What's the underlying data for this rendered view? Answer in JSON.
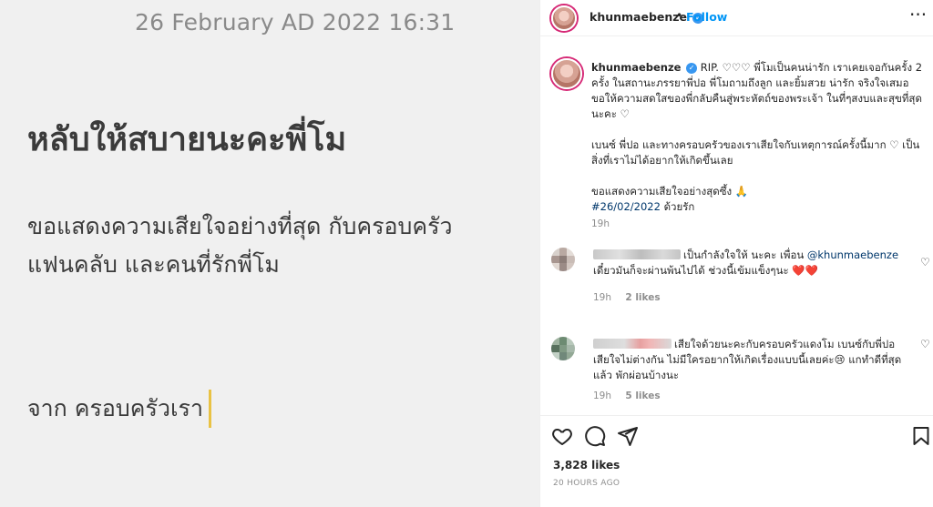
{
  "post_image": {
    "date": "26 February AD 2022 16:31",
    "headline": "หลับให้สบายนะคะพี่โม",
    "body_line1": "ขอแสดงความเสียใจอย่างที่สุด กับครอบครัว",
    "body_line2": "แฟนคลับ และคนที่รักพี่โม",
    "signature": "จาก ครอบครัวเรา"
  },
  "header": {
    "username": "khunmaebenze",
    "verified_icon": "verified-badge-icon",
    "separator": "•",
    "follow_label": "Follow",
    "more_icon": "more-options-icon",
    "more_glyph": "···"
  },
  "caption": {
    "username": "khunmaebenze",
    "para1": "RIP. ♡♡♡ พี่โมเป็นคนน่ารัก เราเคยเจอกันครั้ง 2 ครั้ง ในสถานะภรรยาพี่ปอ พี่โมถามถึงลูก และยิ้มสวย น่ารัก จริงใจเสมอ ขอให้ความสดใสของพี่กลับคืนสู่พระหัตถ์ของพระเจ้า ในที่ๆสงบและสุขที่สุดนะคะ ♡",
    "para2": "เบนซ์ พี่ปอ และทางครอบครัวของเราเสียใจกับเหตุการณ์ครั้งนี้มาก ♡ เป็นสิ่งที่เราไม่ได้อยากให้เกิดขึ้นเลย",
    "para3": "ขอแสดงความเสียใจอย่างสุดซึ้ง 🙏",
    "hashtag": "#26/02/2022",
    "closing": "ด้วยรัก",
    "time": "19h"
  },
  "comments": [
    {
      "text_a": "เป็นกำลังใจให้ นะคะ เพื่อน ",
      "mention": "@khunmaebenze",
      "text_b": "เดี๋ยวมันก็จะผ่านพ้นไปได้ ช่วงนี้เข้มแข็งๆนะ ❤️❤️",
      "time": "19h",
      "likes": "2 likes"
    },
    {
      "text_a": "เสียใจด้วยนะคะกับครอบครัวแดงโม เบนซ์กับพี่ปอเสียใจไม่ต่างกัน ไม่มีใครอยากให้เกิดเรื่องแบบนี้เลยค่ะ😢 แกทำดีที่สุดแล้ว พักผ่อนบ้างนะ",
      "time": "19h",
      "likes": "5 likes"
    }
  ],
  "actions": {
    "like_icon": "heart-icon",
    "comment_icon": "comment-icon",
    "share_icon": "share-icon",
    "save_icon": "bookmark-icon",
    "likes_count": "3,828 likes",
    "time_ago": "20 HOURS AGO"
  }
}
